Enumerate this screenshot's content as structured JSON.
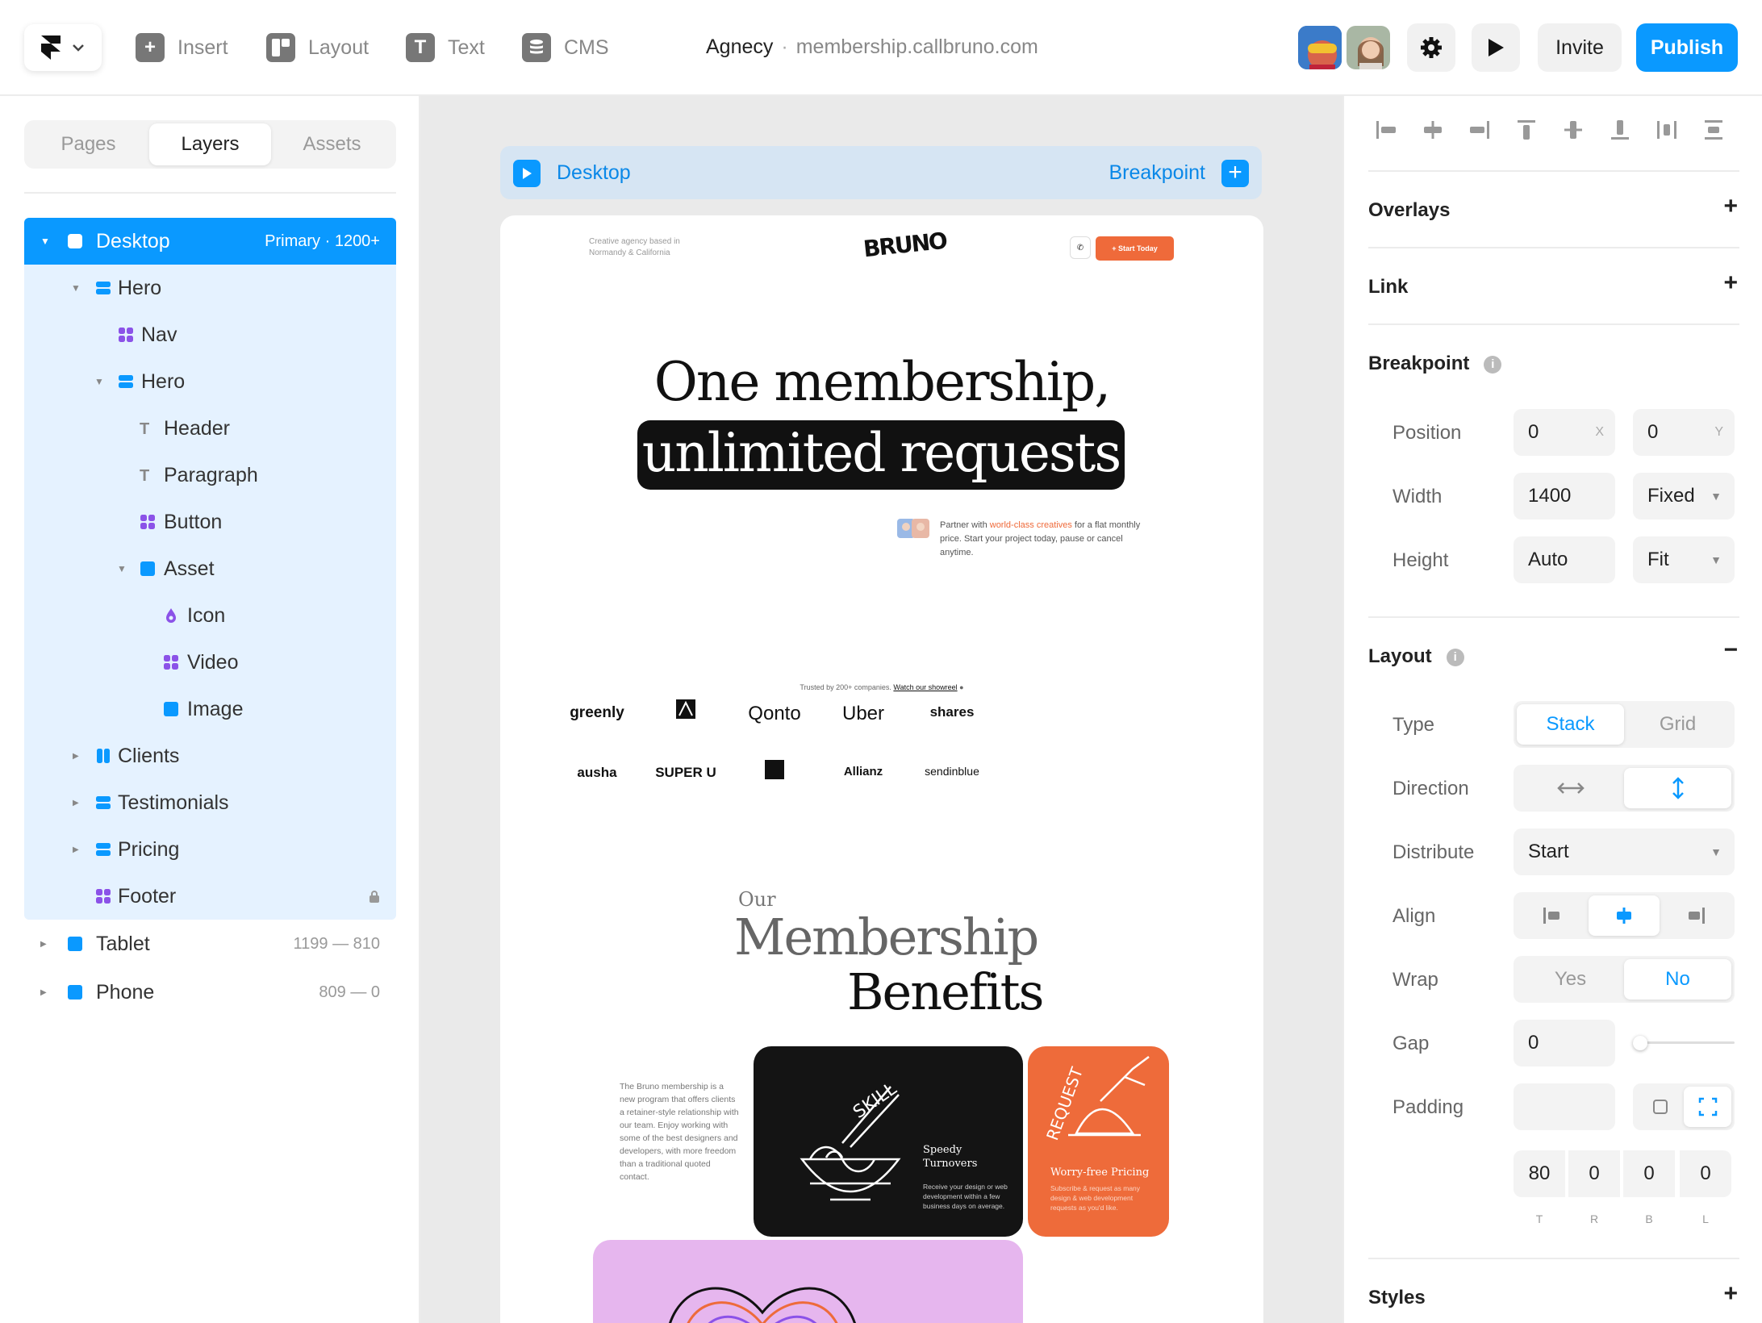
{
  "topbar": {
    "tools": [
      {
        "label": "Insert",
        "icon": "plus-square-icon"
      },
      {
        "label": "Layout",
        "icon": "layout-icon"
      },
      {
        "label": "Text",
        "icon": "text-icon"
      },
      {
        "label": "CMS",
        "icon": "database-icon"
      }
    ],
    "project_name": "Agnecy",
    "separator": "·",
    "project_url": "membership.callbruno.com",
    "invite_label": "Invite",
    "publish_label": "Publish"
  },
  "left": {
    "tabs": [
      "Pages",
      "Layers",
      "Assets"
    ],
    "active_tab": "Layers",
    "layers": [
      {
        "name": "Desktop",
        "meta": "Primary · 1200+"
      },
      {
        "name": "Hero"
      },
      {
        "name": "Nav"
      },
      {
        "name": "Hero"
      },
      {
        "name": "Header"
      },
      {
        "name": "Paragraph"
      },
      {
        "name": "Button"
      },
      {
        "name": "Asset"
      },
      {
        "name": "Icon"
      },
      {
        "name": "Video"
      },
      {
        "name": "Image"
      },
      {
        "name": "Clients"
      },
      {
        "name": "Testimonials"
      },
      {
        "name": "Pricing"
      },
      {
        "name": "Footer"
      },
      {
        "name": "Tablet",
        "meta": "1199 — 810"
      },
      {
        "name": "Phone",
        "meta": "809 — 0"
      }
    ]
  },
  "canvas": {
    "breakpoint_label": "Desktop",
    "breakpoint_action": "Breakpoint",
    "site": {
      "tagline": "Creative agency based in Normandy & California",
      "logo": "BRUNO",
      "cta": "+ Start Today",
      "headline_1": "One membership,",
      "headline_2": "unlimited requests",
      "partner_pre": "Partner with ",
      "partner_hl": "world-class creatives",
      "partner_post": " for a flat monthly price. Start your project today, pause or cancel anytime.",
      "trusted_pre": "Trusted by 200+ companies. ",
      "trusted_link": "Watch our showreel",
      "clients": [
        "greenly",
        "AXA",
        "Qonto",
        "Uber",
        "shares",
        "ausha",
        "SUPER U",
        "orange",
        "Allianz",
        "sendinblue"
      ],
      "our": "Our",
      "membership": "Membership",
      "benefits": "Benefits",
      "description": "The Bruno membership is a new program that offers clients a retainer-style relationship with our team. Enjoy working with some of the best designers and developers, with more freedom than a traditional quoted contact.",
      "card1_title": "Speedy Turnovers",
      "card1_text": "Receive your design or web development within a few business days on average.",
      "card1_art": "SKILL",
      "card2_title": "Worry-free Pricing",
      "card2_text": "Subscribe & request as many design & web development requests as you'd like.",
      "card2_art": "REQUEST"
    }
  },
  "right": {
    "overlays_label": "Overlays",
    "link_label": "Link",
    "breakpoint_label": "Breakpoint",
    "info_glyph": "i",
    "position_label": "Position",
    "position_x": "0",
    "position_x_suffix": "X",
    "position_y": "0",
    "position_y_suffix": "Y",
    "width_label": "Width",
    "width_value": "1400",
    "width_mode": "Fixed",
    "height_label": "Height",
    "height_value": "Auto",
    "height_mode": "Fit",
    "layout_label": "Layout",
    "type_label": "Type",
    "type_options": [
      "Stack",
      "Grid"
    ],
    "type_selected": "Stack",
    "direction_label": "Direction",
    "distribute_label": "Distribute",
    "distribute_value": "Start",
    "align_label": "Align",
    "wrap_label": "Wrap",
    "wrap_options": [
      "Yes",
      "No"
    ],
    "wrap_selected": "No",
    "gap_label": "Gap",
    "gap_value": "0",
    "gap_slider": 0,
    "padding_label": "Padding",
    "padding_values": [
      "80",
      "0",
      "0",
      "0"
    ],
    "padding_sides": [
      "T",
      "R",
      "B",
      "L"
    ],
    "styles_label": "Styles"
  },
  "colors": {
    "accent": "#0a99ff",
    "selection": "#e5f2ff",
    "brand_orange": "#ee6b3a",
    "card_purple": "#e6b6ee"
  }
}
